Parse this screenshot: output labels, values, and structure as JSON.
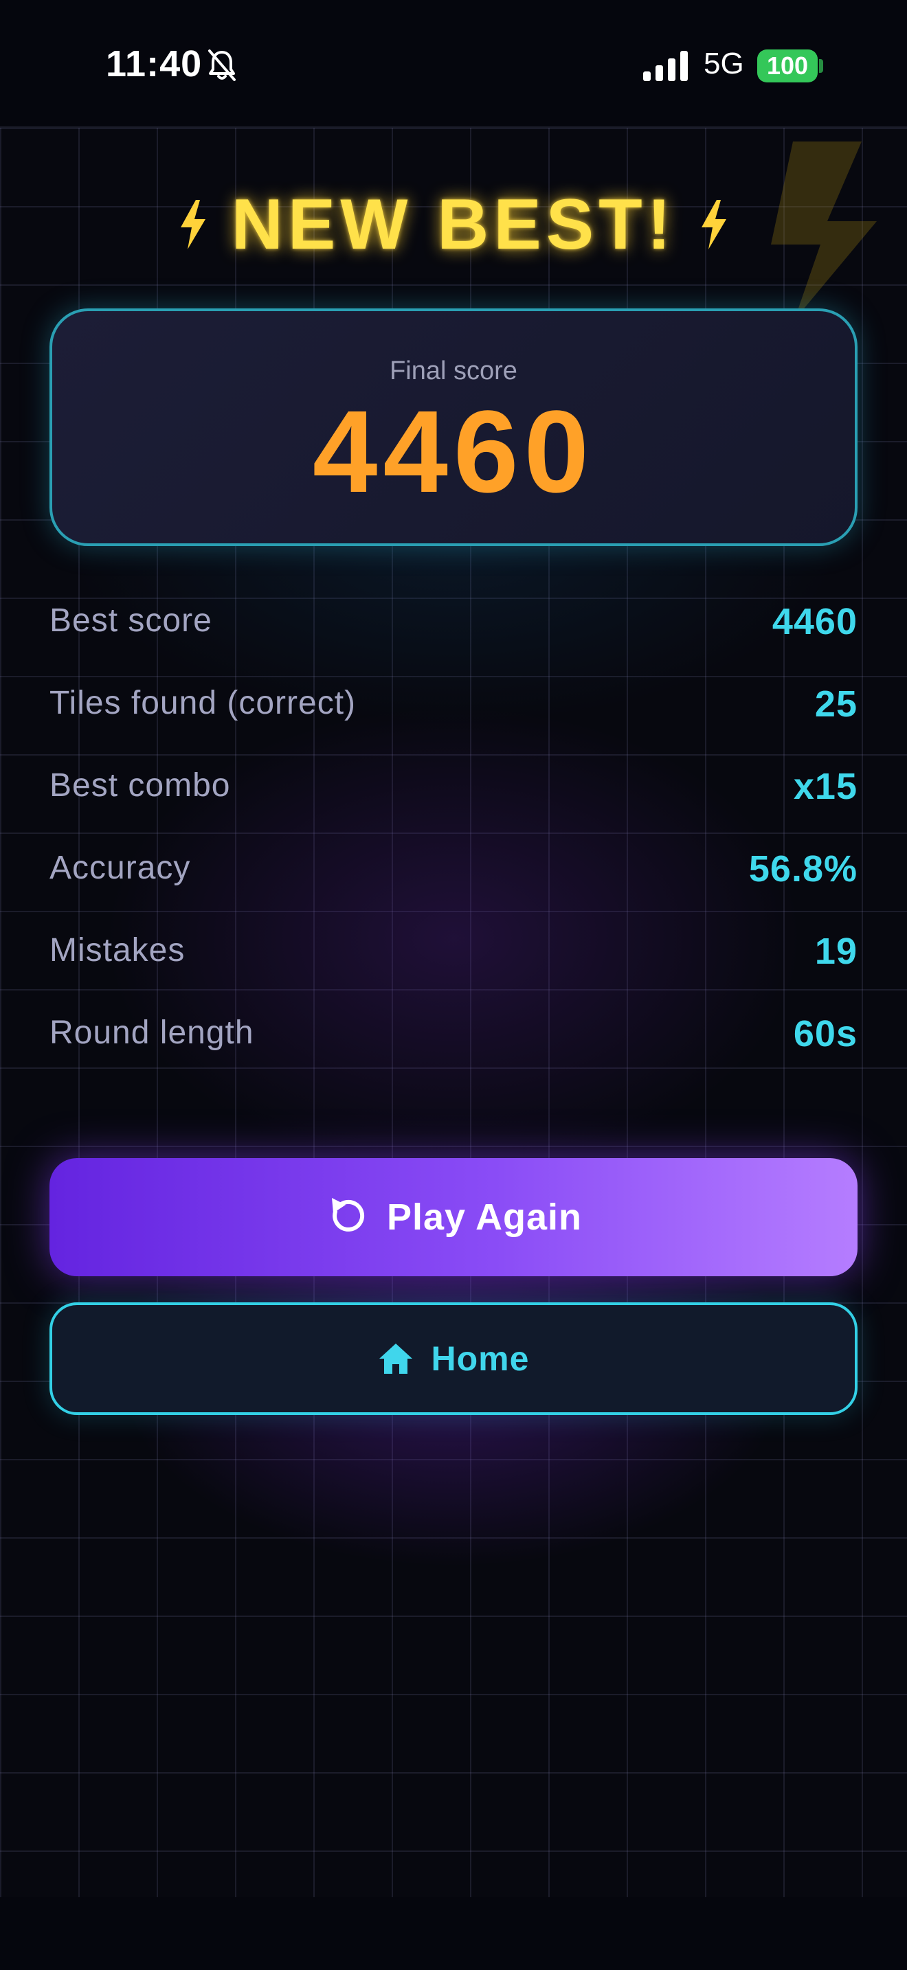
{
  "status_bar": {
    "time": "11:40",
    "network": "5G",
    "battery": "100",
    "icons": [
      "bell-slash-icon",
      "signal-bars-icon"
    ]
  },
  "result": {
    "title": "NEW BEST!",
    "title_icon": "lightning-bolt-icon",
    "score_label": "Final score",
    "score_value": "4460"
  },
  "stats": [
    {
      "label": "Best score",
      "value": "4460"
    },
    {
      "label": "Tiles found (correct)",
      "value": "25"
    },
    {
      "label": "Best combo",
      "value": "x15"
    },
    {
      "label": "Accuracy",
      "value": "56.8%"
    },
    {
      "label": "Mistakes",
      "value": "19"
    },
    {
      "label": "Round length",
      "value": "60s"
    }
  ],
  "buttons": {
    "play_again": "Play Again",
    "play_again_icon": "replay-icon",
    "home": "Home",
    "home_icon": "home-icon"
  },
  "colors": {
    "title": "#ffe14a",
    "score": "#ffa128",
    "stat_value": "#3fd8ec",
    "stat_label": "#a3a5c2",
    "primary_button_start": "#6424e0",
    "primary_button_end": "#b57dff",
    "secondary_button_border": "#33d0e6",
    "battery": "#34c759"
  }
}
